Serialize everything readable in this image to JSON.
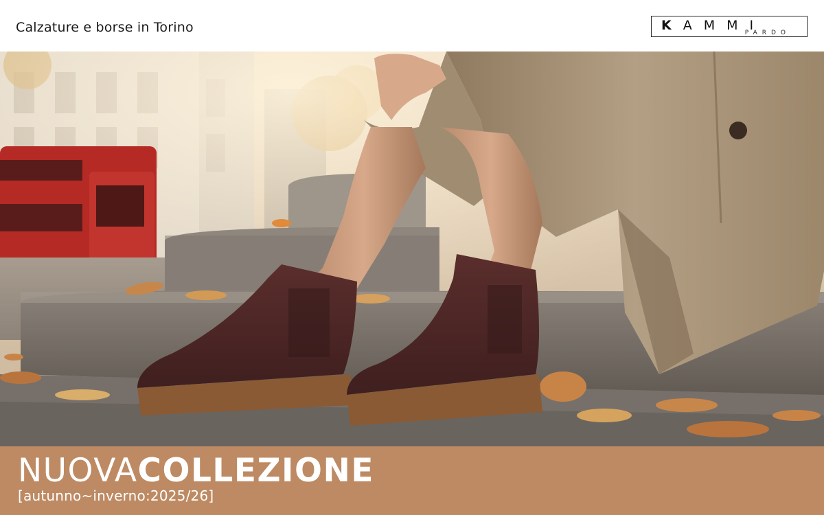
{
  "header": {
    "tagline": "Calzature e borse in Torino",
    "logo": {
      "main": "KAMMI",
      "sub": "PARDO"
    }
  },
  "hero": {
    "image": "woman-sitting-on-steps-wearing-burgundy-chelsea-boots-photo"
  },
  "banner": {
    "title_light": "NUOVA",
    "title_bold": "COLLEZIONE",
    "subtitle": "[autunno~inverno:2025/26]",
    "color": "#bd8a63"
  }
}
